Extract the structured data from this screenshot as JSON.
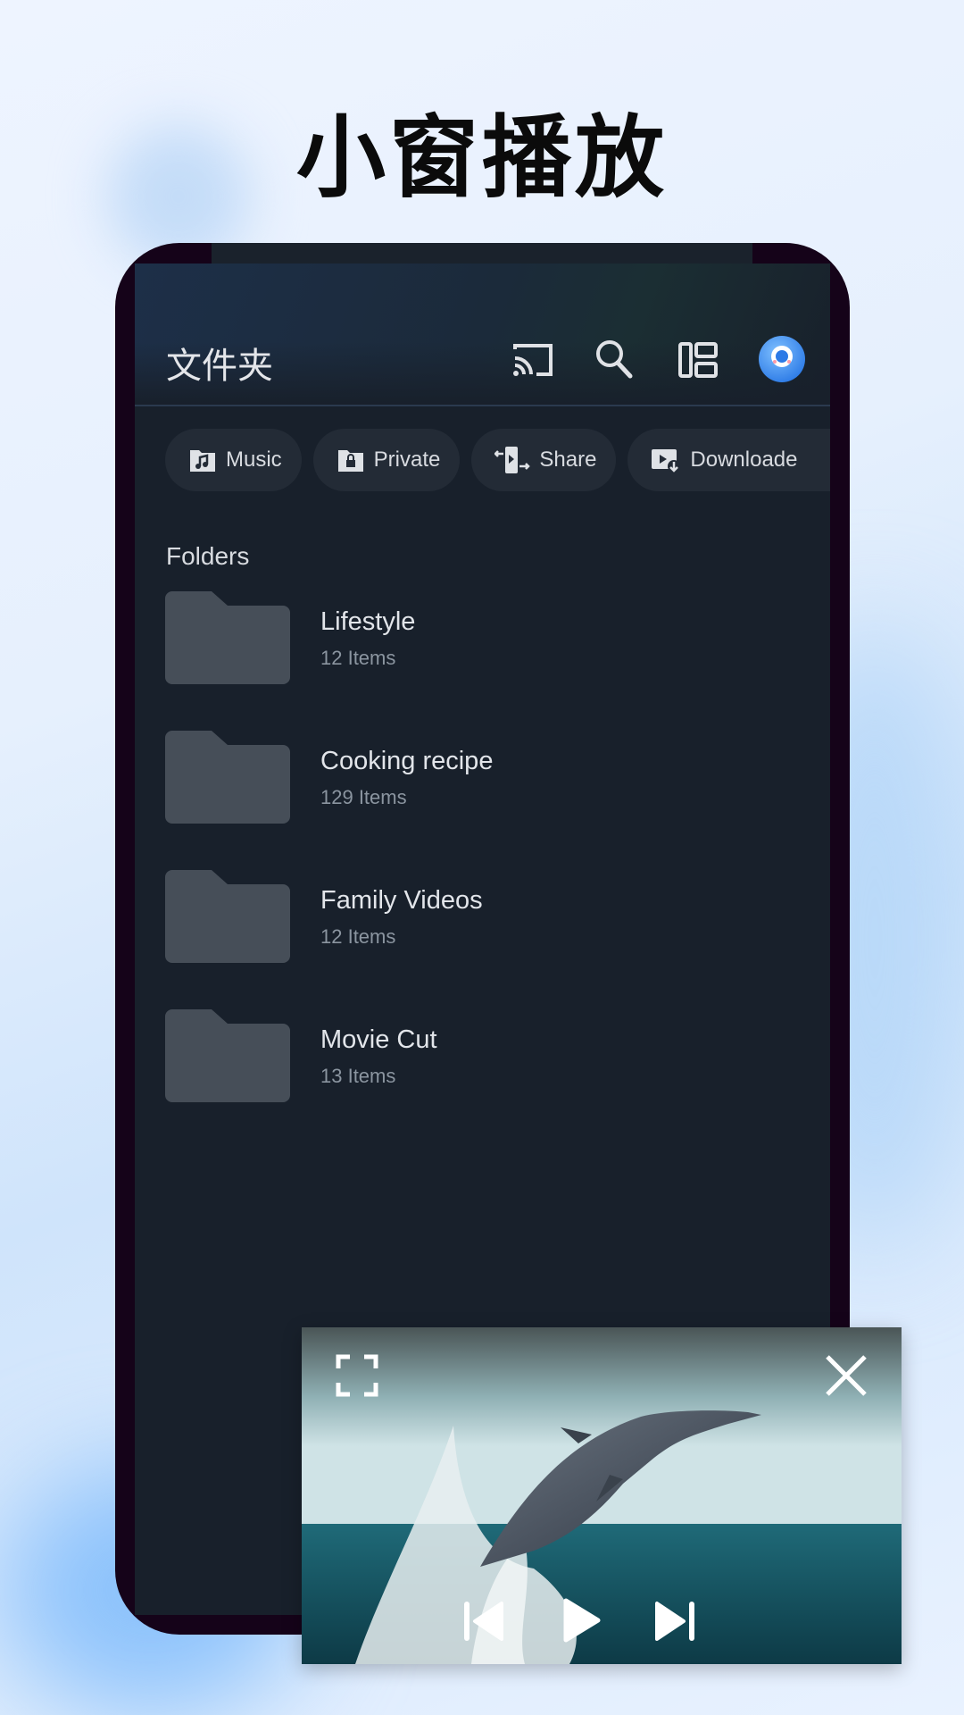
{
  "headline": "小窗播放",
  "app": {
    "title": "文件夹",
    "toolbar": {
      "icons": [
        "cast-icon",
        "search-icon",
        "layout-icon",
        "avatar-icon"
      ]
    },
    "chips": [
      {
        "label": "Music",
        "icon": "music-folder-icon"
      },
      {
        "label": "Private",
        "icon": "lock-folder-icon"
      },
      {
        "label": "Share",
        "icon": "share-transfer-icon"
      },
      {
        "label": "Downloade",
        "icon": "download-video-icon"
      }
    ],
    "section_label": "Folders",
    "folders": [
      {
        "name": "Lifestyle",
        "count": "12 Items"
      },
      {
        "name": "Cooking recipe",
        "count": "129 Items"
      },
      {
        "name": "Family Videos",
        "count": "12 Items"
      },
      {
        "name": "Movie Cut",
        "count": "13 Items"
      }
    ]
  },
  "pip": {
    "controls": [
      "fullscreen-icon",
      "close-icon",
      "previous-icon",
      "play-icon",
      "next-icon"
    ]
  },
  "colors": {
    "screen_bg": "#18202b",
    "chip_bg": "#232b36",
    "folder": "#464e58",
    "accent": "#3d8ef0"
  }
}
